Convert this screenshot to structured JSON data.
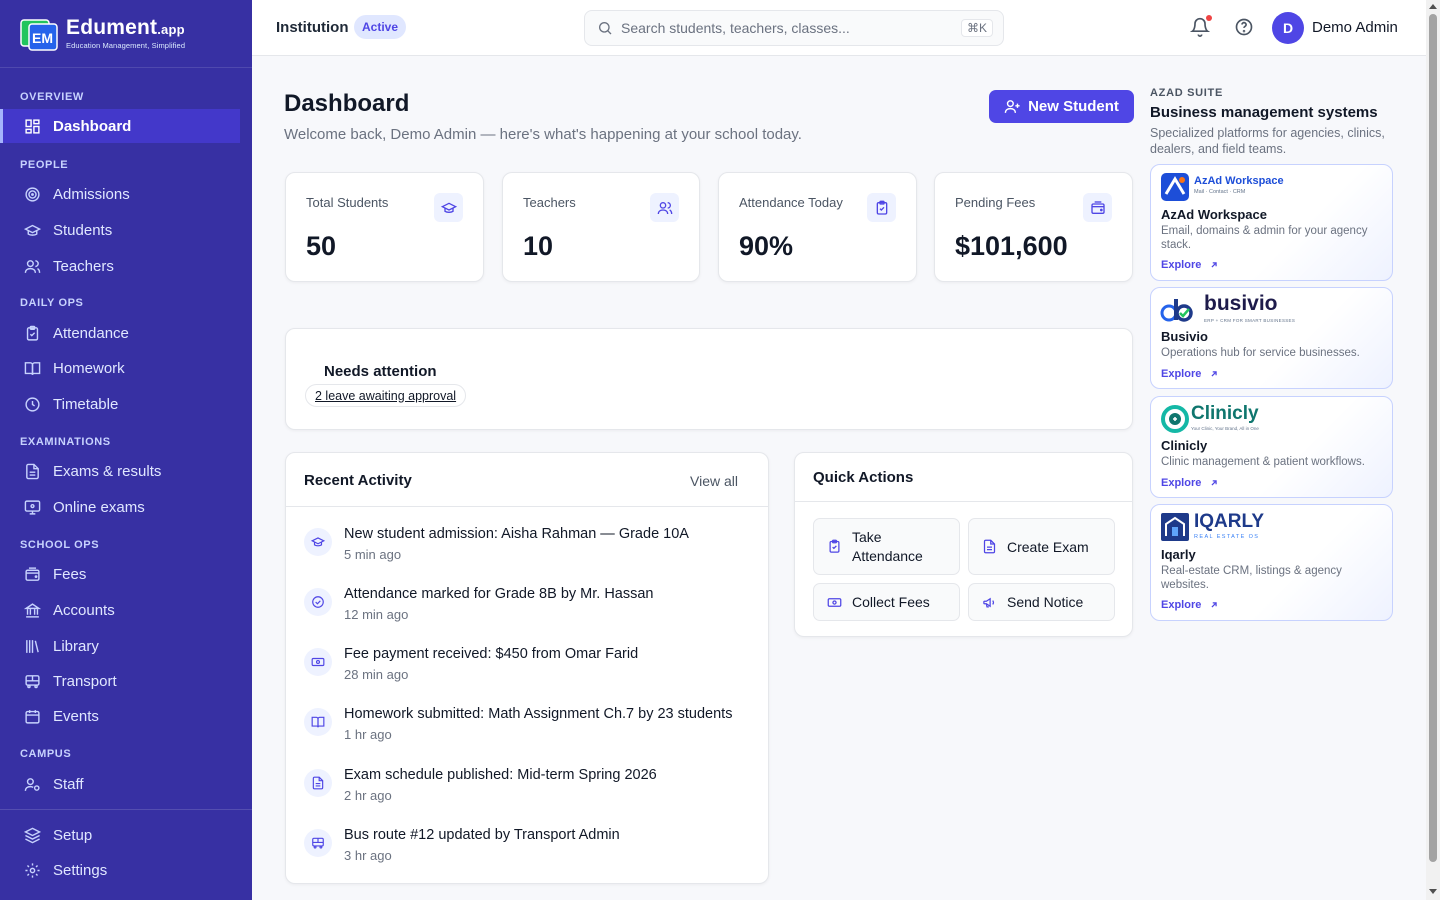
{
  "brand": {
    "name": "Edument",
    "suffix": ".app",
    "tagline": "Education Management, Simplified"
  },
  "sidebar": {
    "sections": [
      {
        "label": "OVERVIEW"
      },
      {
        "label": "PEOPLE"
      },
      {
        "label": "DAILY OPS"
      },
      {
        "label": "EXAMINATIONS"
      },
      {
        "label": "SCHOOL OPS"
      },
      {
        "label": "CAMPUS"
      }
    ],
    "items": [
      {
        "label": "Dashboard",
        "icon": "grid-icon",
        "active": true
      },
      {
        "label": "Admissions",
        "icon": "target-icon"
      },
      {
        "label": "Students",
        "icon": "graduation-cap-icon"
      },
      {
        "label": "Teachers",
        "icon": "users-icon"
      },
      {
        "label": "Attendance",
        "icon": "clipboard-check-icon"
      },
      {
        "label": "Homework",
        "icon": "book-open-icon"
      },
      {
        "label": "Timetable",
        "icon": "clock-icon"
      },
      {
        "label": "Exams & results",
        "icon": "file-text-icon"
      },
      {
        "label": "Online exams",
        "icon": "monitor-icon"
      },
      {
        "label": "Fees",
        "icon": "wallet-icon"
      },
      {
        "label": "Accounts",
        "icon": "bank-icon"
      },
      {
        "label": "Library",
        "icon": "library-icon"
      },
      {
        "label": "Transport",
        "icon": "bus-icon"
      },
      {
        "label": "Events",
        "icon": "calendar-icon"
      },
      {
        "label": "Staff",
        "icon": "user-cog-icon"
      },
      {
        "label": "Setup",
        "icon": "layers-icon"
      },
      {
        "label": "Settings",
        "icon": "gear-icon"
      }
    ]
  },
  "topbar": {
    "institution": "Institution",
    "status": "Active",
    "search_placeholder": "Search students, teachers, classes...",
    "shortcut": "⌘K",
    "user_initial": "D",
    "user_name": "Demo Admin"
  },
  "main": {
    "title": "Dashboard",
    "subtitle": "Welcome back, Demo Admin — here's what's happening at your school today.",
    "new_student": "New Student",
    "stats": [
      {
        "label": "Total Students",
        "value": "50",
        "icon": "graduation-cap-icon"
      },
      {
        "label": "Teachers",
        "value": "10",
        "icon": "users-icon"
      },
      {
        "label": "Attendance Today",
        "value": "90%",
        "icon": "clipboard-check-icon"
      },
      {
        "label": "Pending Fees",
        "value": "$101,600",
        "icon": "wallet-icon"
      }
    ],
    "needs_attention": {
      "title": "Needs attention",
      "item": "2 leave awaiting approval"
    },
    "recent_activity": {
      "title": "Recent Activity",
      "view_all": "View all",
      "items": [
        {
          "text": "New student admission: Aisha Rahman — Grade 10A",
          "time": "5 min ago",
          "icon": "graduation-cap-icon"
        },
        {
          "text": "Attendance marked for Grade 8B by Mr. Hassan",
          "time": "12 min ago",
          "icon": "check-circle-icon"
        },
        {
          "text": "Fee payment received: $450 from Omar Farid",
          "time": "28 min ago",
          "icon": "banknote-icon"
        },
        {
          "text": "Homework submitted: Math Assignment Ch.7 by 23 students",
          "time": "1 hr ago",
          "icon": "book-open-icon"
        },
        {
          "text": "Exam schedule published: Mid-term Spring 2026",
          "time": "2 hr ago",
          "icon": "file-text-icon"
        },
        {
          "text": "Bus route #12 updated by Transport Admin",
          "time": "3 hr ago",
          "icon": "bus-icon"
        }
      ]
    },
    "quick_actions": {
      "title": "Quick Actions",
      "items": [
        {
          "label": "Take Attendance",
          "icon": "clipboard-check-icon"
        },
        {
          "label": "Create Exam",
          "icon": "file-text-icon"
        },
        {
          "label": "Collect Fees",
          "icon": "banknote-icon"
        },
        {
          "label": "Send Notice",
          "icon": "megaphone-icon"
        }
      ]
    }
  },
  "suite": {
    "label": "AZAD SUITE",
    "title": "Business management systems",
    "description": "Specialized platforms for agencies, clinics, dealers, and field teams.",
    "explore": "Explore",
    "products": [
      {
        "logo_text": "AzAd Workspace",
        "logo_sub": "Mail · Contact · CRM",
        "name": "AzAd Workspace",
        "desc": "Email, domains & admin for your agency stack."
      },
      {
        "logo_text": "busivio",
        "logo_sub": "ERP + CRM FOR SMART BUSINESSES",
        "name": "Busivio",
        "desc": "Operations hub for service businesses."
      },
      {
        "logo_text": "Clinicly",
        "logo_sub": "Your Clinic, Your Brand, All in One",
        "name": "Clinicly",
        "desc": "Clinic management & patient workflows."
      },
      {
        "logo_text": "IQARLY",
        "logo_sub": "REAL ESTATE OS",
        "name": "Iqarly",
        "desc": "Real-estate CRM, listings & agency websites."
      }
    ]
  },
  "colors": {
    "sidebar": "#3730a3",
    "accent": "#4f46e5",
    "active_item": "#4338ca"
  }
}
